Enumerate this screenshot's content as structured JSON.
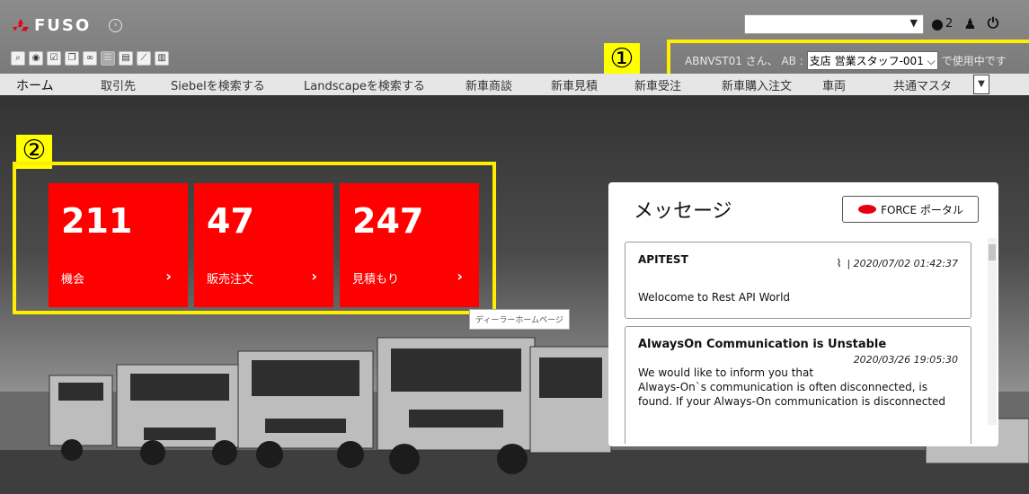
{
  "header": {
    "brand": "FUSO",
    "user_select": {
      "value": ""
    },
    "notification_count": "2",
    "marker_1": "①",
    "marker_2": "②"
  },
  "user_info": {
    "greeting": "ABNVST01 さん、 AB :",
    "role_select": "支店 営業スタッフ-001",
    "suffix": "で使用中です"
  },
  "nav": {
    "tabs": [
      {
        "label": "ホーム"
      },
      {
        "label": "取引先"
      },
      {
        "label": "Siebelを検索する"
      },
      {
        "label": "Landscapeを検索する"
      },
      {
        "label": "新車商談"
      },
      {
        "label": "新車見積"
      },
      {
        "label": "新車受注"
      },
      {
        "label": "新車購入注文"
      },
      {
        "label": "車両"
      },
      {
        "label": "共通マスタ"
      }
    ]
  },
  "tiles": [
    {
      "count": "211",
      "label": "機会"
    },
    {
      "count": "47",
      "label": "販売注文"
    },
    {
      "count": "247",
      "label": "見積もり"
    }
  ],
  "dealer_tooltip": "ディーラーホームページ",
  "messages": {
    "title": "メッセージ",
    "portal_button": "FORCE ポータル",
    "items": [
      {
        "title": "APITEST",
        "date": "| 2020/07/02 01:42:37",
        "body": "Welocome to Rest API World"
      },
      {
        "title": "AlwaysOn Communication is Unstable",
        "date": "2020/03/26 19:05:30",
        "body_lines": [
          "We would like to inform you that",
          "Always-On`s communication is often disconnected, is",
          "found. If your Always-On communication is disconnected"
        ]
      }
    ]
  },
  "colors": {
    "tile": "#ff0000",
    "highlight": "#ffee00"
  }
}
